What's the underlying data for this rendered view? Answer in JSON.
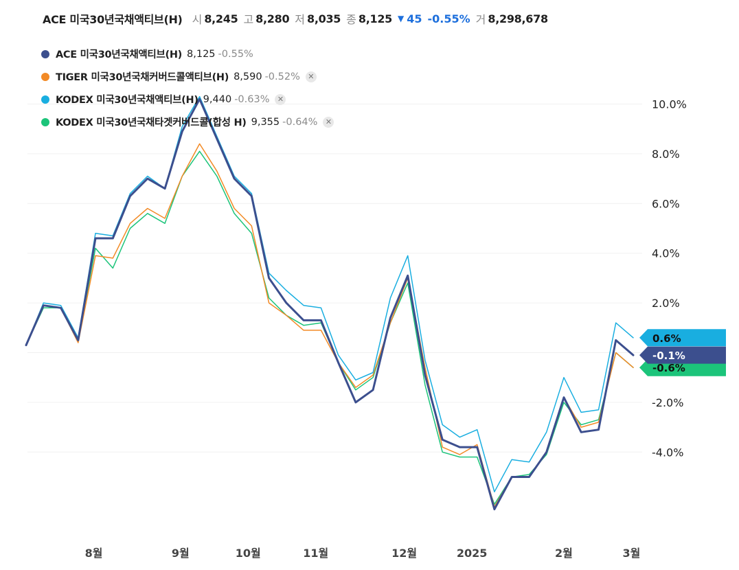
{
  "header": {
    "name": "ACE 미국30년국채액티브(H)",
    "open_label": "시",
    "open": "8,245",
    "high_label": "고",
    "high": "8,280",
    "low_label": "저",
    "low": "8,035",
    "close_label": "종",
    "close": "8,125",
    "change": "45",
    "change_pct": "-0.55%",
    "volume_label": "거",
    "volume": "8,298,678"
  },
  "legend": [
    {
      "name": "ACE 미국30년국채액티브(H)",
      "price": "8,125",
      "pct": "-0.55%",
      "color": "#3c4f8e",
      "closable": false
    },
    {
      "name": "TIGER 미국30년국채커버드콜액티브(H)",
      "price": "8,590",
      "pct": "-0.52%",
      "color": "#f28a26",
      "closable": true
    },
    {
      "name": "KODEX 미국30년국채액티브(H)",
      "price": "9,440",
      "pct": "-0.63%",
      "color": "#19aee0",
      "closable": true
    },
    {
      "name": "KODEX 미국30년국채타겟커버드콜(합성 H)",
      "price": "9,355",
      "pct": "-0.64%",
      "color": "#1cc47a",
      "closable": true
    }
  ],
  "chart_data": {
    "type": "line",
    "ylim": [
      -7,
      10.5
    ],
    "yticks": [
      "10.0%",
      "8.0%",
      "6.0%",
      "4.0%",
      "2.0%",
      "-2.0%",
      "-4.0%"
    ],
    "ytick_values": [
      10,
      8,
      6,
      4,
      2,
      -2,
      -4
    ],
    "xticks": [
      "8월",
      "9월",
      "10월",
      "11월",
      "12월",
      "2025",
      "2월",
      "3월"
    ],
    "xtick_index": [
      3.9,
      8.9,
      12.8,
      16.7,
      21.8,
      25.7,
      31.0,
      34.9
    ],
    "n_points": 36,
    "series": [
      {
        "name": "ACE 미국30년국채액티브(H)",
        "color": "#3c4f8e",
        "width": 3,
        "end_label": "-0.1%",
        "end_value": -0.1,
        "values": [
          0.3,
          1.9,
          1.8,
          0.5,
          4.6,
          4.6,
          6.3,
          7.0,
          6.6,
          8.9,
          10.2,
          8.6,
          7.0,
          6.3,
          3.0,
          2.0,
          1.3,
          1.3,
          -0.4,
          -2.0,
          -1.5,
          1.4,
          3.1,
          -0.9,
          -3.5,
          -3.8,
          -3.8,
          -6.3,
          -5.0,
          -5.0,
          -4.0,
          -1.8,
          -3.2,
          -3.1,
          0.5,
          -0.1
        ]
      },
      {
        "name": "TIGER 미국30년국채커버드콜액티브(H)",
        "color": "#f28a26",
        "width": 1.5,
        "end_label": "",
        "end_value": -0.6,
        "values": [
          0.3,
          1.9,
          1.8,
          0.4,
          3.9,
          3.8,
          5.2,
          5.8,
          5.4,
          7.1,
          8.4,
          7.3,
          5.8,
          5.1,
          2.0,
          1.5,
          0.9,
          0.9,
          -0.4,
          -1.4,
          -0.9,
          1.2,
          3.0,
          -0.6,
          -3.8,
          -4.1,
          -3.7,
          -6.2,
          -5.0,
          -5.0,
          -4.0,
          -1.8,
          -3.0,
          -2.8,
          0.0,
          -0.6
        ]
      },
      {
        "name": "KODEX 미국30년국채액티브(H)",
        "color": "#19aee0",
        "width": 1.5,
        "end_label": "0.6%",
        "end_value": 0.6,
        "values": [
          0.3,
          2.0,
          1.9,
          0.6,
          4.8,
          4.7,
          6.4,
          7.1,
          6.6,
          9.1,
          10.3,
          8.7,
          7.1,
          6.4,
          3.2,
          2.5,
          1.9,
          1.8,
          -0.1,
          -1.1,
          -0.8,
          2.2,
          3.9,
          -0.3,
          -2.9,
          -3.4,
          -3.1,
          -5.6,
          -4.3,
          -4.4,
          -3.2,
          -1.0,
          -2.4,
          -2.3,
          1.2,
          0.6
        ]
      },
      {
        "name": "KODEX 미국30년국채타겟커버드콜(합성 H)",
        "color": "#1cc47a",
        "width": 1.5,
        "end_label": "-0.6%",
        "end_value": -0.6,
        "values": [
          0.3,
          1.8,
          1.8,
          0.5,
          4.2,
          3.4,
          5.0,
          5.6,
          5.2,
          7.1,
          8.1,
          7.1,
          5.6,
          4.8,
          2.2,
          1.5,
          1.1,
          1.2,
          -0.4,
          -1.5,
          -1.0,
          1.2,
          2.8,
          -1.3,
          -4.0,
          -4.2,
          -4.2,
          -6.1,
          -5.0,
          -4.9,
          -4.1,
          -2.0,
          -2.9,
          -2.7,
          0.0,
          -0.6
        ]
      }
    ]
  }
}
